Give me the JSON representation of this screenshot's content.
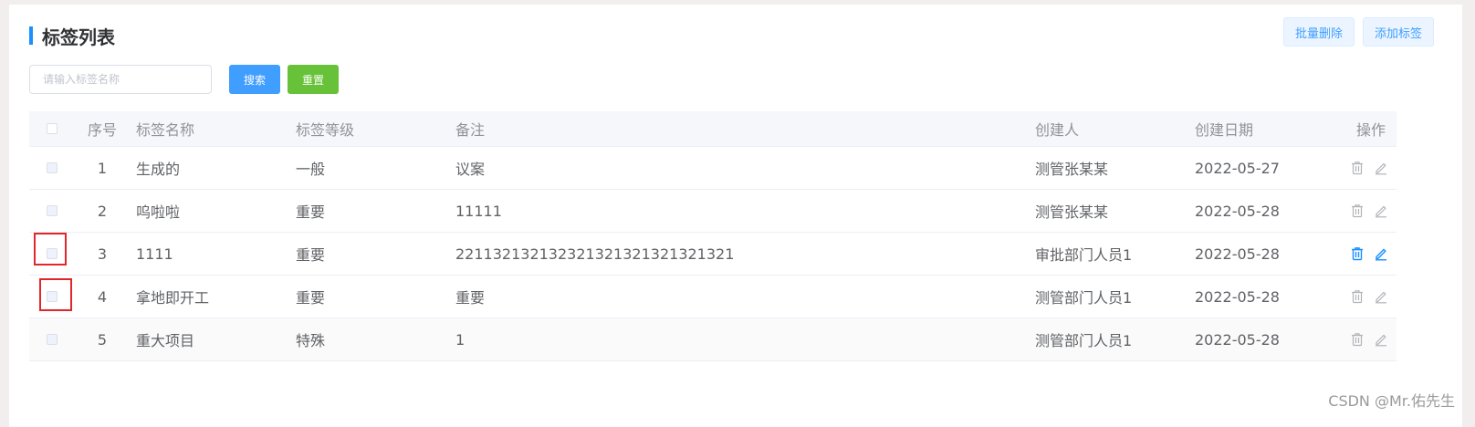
{
  "page": {
    "title": "标签列表",
    "top_buttons": {
      "batch_delete": "批量删除",
      "add_tag": "添加标签"
    },
    "search": {
      "placeholder": "请输入标签名称",
      "value": "",
      "search_label": "搜索",
      "reset_label": "重置"
    }
  },
  "table": {
    "headers": {
      "index": "序号",
      "name": "标签名称",
      "level": "标签等级",
      "remark": "备注",
      "creator": "创建人",
      "date": "创建日期",
      "ops": "操作"
    },
    "rows": [
      {
        "index": "1",
        "name": "生成的",
        "level": "一般",
        "remark": "议案",
        "creator": "测管张某某",
        "date": "2022-05-27"
      },
      {
        "index": "2",
        "name": "呜啦啦",
        "level": "重要",
        "remark": "11111",
        "creator": "测管张某某",
        "date": "2022-05-28"
      },
      {
        "index": "3",
        "name": "1111",
        "level": "重要",
        "remark": "2211321321323213213213213213​21",
        "creator": "审批部门人员1",
        "date": "2022-05-28"
      },
      {
        "index": "4",
        "name": "拿地即开工",
        "level": "重要",
        "remark": "重要",
        "creator": "测管部门人员1",
        "date": "2022-05-28"
      },
      {
        "index": "5",
        "name": "重大项目",
        "level": "特殊",
        "remark": "1",
        "creator": "测管部门人员1",
        "date": "2022-05-28"
      }
    ],
    "hovered_row": 3
  },
  "icons": {
    "delete": "trash-icon",
    "edit": "pencil-icon"
  },
  "colors": {
    "accent": "#1890ff",
    "primary": "#409eff",
    "success": "#67c23a",
    "highlight": "#e3262a"
  },
  "watermark": "CSDN @Mr.佑先生"
}
